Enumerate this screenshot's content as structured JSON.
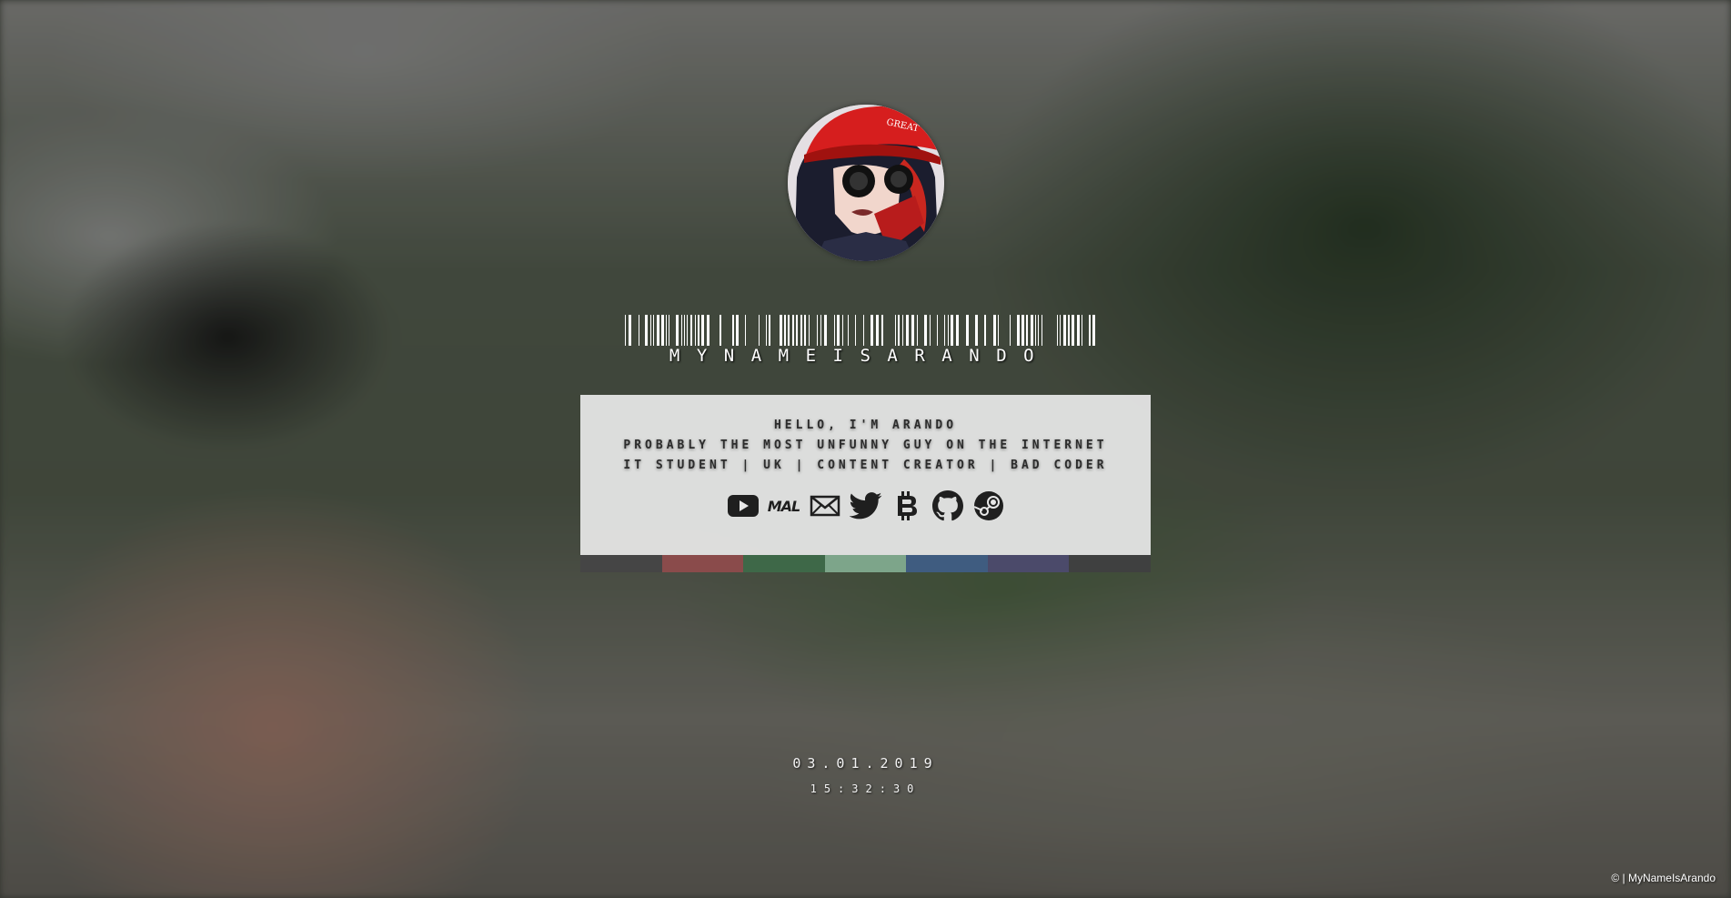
{
  "header": {
    "site_name": "MYNAMEISARANDO"
  },
  "card": {
    "line1": "HELLO, I'M ARANDO",
    "line2": "PROBABLY THE MOST UNFUNNY GUY ON THE INTERNET",
    "line3": "IT STUDENT | UK | CONTENT CREATOR | BAD CODER",
    "socials": [
      {
        "icon": "youtube-icon"
      },
      {
        "icon": "mal-icon",
        "label": "MAL"
      },
      {
        "icon": "mail-icon"
      },
      {
        "icon": "twitter-icon"
      },
      {
        "icon": "bitcoin-icon"
      },
      {
        "icon": "github-icon"
      },
      {
        "icon": "steam-icon"
      }
    ]
  },
  "palette": [
    "#454545",
    "#8a4b4b",
    "#3e6848",
    "#7da58a",
    "#3f5c80",
    "#4b4a6a",
    "#3f4040"
  ],
  "clock": {
    "date": "03.01.2019",
    "time": "15:32:30"
  },
  "footer": {
    "copyright": "© | MyNameIsArando"
  }
}
